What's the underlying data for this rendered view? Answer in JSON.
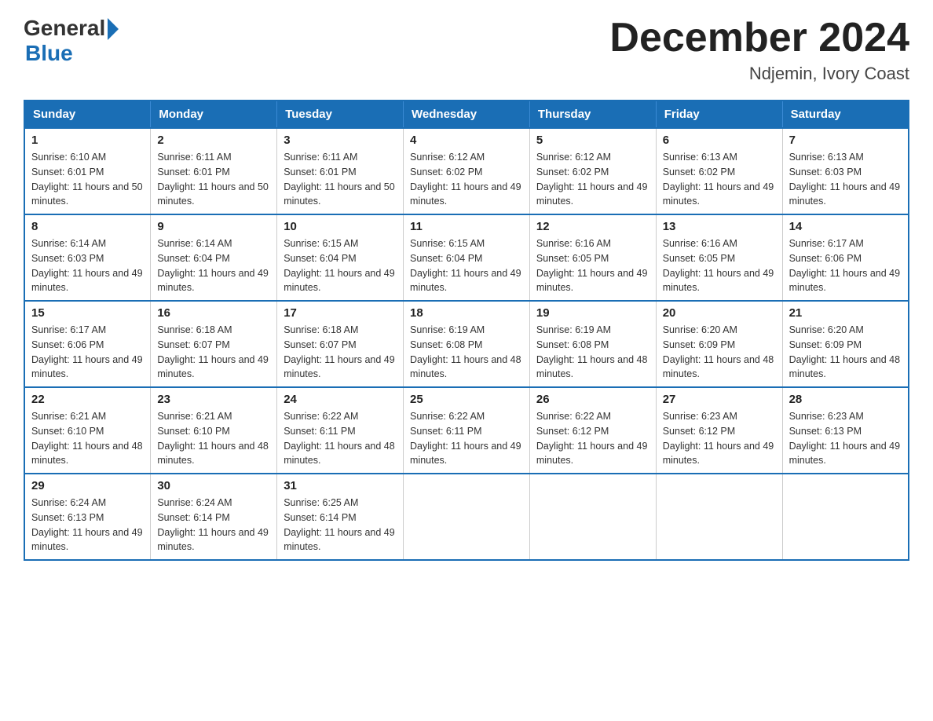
{
  "logo": {
    "general": "General",
    "blue": "Blue"
  },
  "title": {
    "month": "December 2024",
    "location": "Ndjemin, Ivory Coast"
  },
  "weekdays": [
    "Sunday",
    "Monday",
    "Tuesday",
    "Wednesday",
    "Thursday",
    "Friday",
    "Saturday"
  ],
  "weeks": [
    [
      {
        "day": "1",
        "sunrise": "6:10 AM",
        "sunset": "6:01 PM",
        "daylight": "11 hours and 50 minutes."
      },
      {
        "day": "2",
        "sunrise": "6:11 AM",
        "sunset": "6:01 PM",
        "daylight": "11 hours and 50 minutes."
      },
      {
        "day": "3",
        "sunrise": "6:11 AM",
        "sunset": "6:01 PM",
        "daylight": "11 hours and 50 minutes."
      },
      {
        "day": "4",
        "sunrise": "6:12 AM",
        "sunset": "6:02 PM",
        "daylight": "11 hours and 49 minutes."
      },
      {
        "day": "5",
        "sunrise": "6:12 AM",
        "sunset": "6:02 PM",
        "daylight": "11 hours and 49 minutes."
      },
      {
        "day": "6",
        "sunrise": "6:13 AM",
        "sunset": "6:02 PM",
        "daylight": "11 hours and 49 minutes."
      },
      {
        "day": "7",
        "sunrise": "6:13 AM",
        "sunset": "6:03 PM",
        "daylight": "11 hours and 49 minutes."
      }
    ],
    [
      {
        "day": "8",
        "sunrise": "6:14 AM",
        "sunset": "6:03 PM",
        "daylight": "11 hours and 49 minutes."
      },
      {
        "day": "9",
        "sunrise": "6:14 AM",
        "sunset": "6:04 PM",
        "daylight": "11 hours and 49 minutes."
      },
      {
        "day": "10",
        "sunrise": "6:15 AM",
        "sunset": "6:04 PM",
        "daylight": "11 hours and 49 minutes."
      },
      {
        "day": "11",
        "sunrise": "6:15 AM",
        "sunset": "6:04 PM",
        "daylight": "11 hours and 49 minutes."
      },
      {
        "day": "12",
        "sunrise": "6:16 AM",
        "sunset": "6:05 PM",
        "daylight": "11 hours and 49 minutes."
      },
      {
        "day": "13",
        "sunrise": "6:16 AM",
        "sunset": "6:05 PM",
        "daylight": "11 hours and 49 minutes."
      },
      {
        "day": "14",
        "sunrise": "6:17 AM",
        "sunset": "6:06 PM",
        "daylight": "11 hours and 49 minutes."
      }
    ],
    [
      {
        "day": "15",
        "sunrise": "6:17 AM",
        "sunset": "6:06 PM",
        "daylight": "11 hours and 49 minutes."
      },
      {
        "day": "16",
        "sunrise": "6:18 AM",
        "sunset": "6:07 PM",
        "daylight": "11 hours and 49 minutes."
      },
      {
        "day": "17",
        "sunrise": "6:18 AM",
        "sunset": "6:07 PM",
        "daylight": "11 hours and 49 minutes."
      },
      {
        "day": "18",
        "sunrise": "6:19 AM",
        "sunset": "6:08 PM",
        "daylight": "11 hours and 48 minutes."
      },
      {
        "day": "19",
        "sunrise": "6:19 AM",
        "sunset": "6:08 PM",
        "daylight": "11 hours and 48 minutes."
      },
      {
        "day": "20",
        "sunrise": "6:20 AM",
        "sunset": "6:09 PM",
        "daylight": "11 hours and 48 minutes."
      },
      {
        "day": "21",
        "sunrise": "6:20 AM",
        "sunset": "6:09 PM",
        "daylight": "11 hours and 48 minutes."
      }
    ],
    [
      {
        "day": "22",
        "sunrise": "6:21 AM",
        "sunset": "6:10 PM",
        "daylight": "11 hours and 48 minutes."
      },
      {
        "day": "23",
        "sunrise": "6:21 AM",
        "sunset": "6:10 PM",
        "daylight": "11 hours and 48 minutes."
      },
      {
        "day": "24",
        "sunrise": "6:22 AM",
        "sunset": "6:11 PM",
        "daylight": "11 hours and 48 minutes."
      },
      {
        "day": "25",
        "sunrise": "6:22 AM",
        "sunset": "6:11 PM",
        "daylight": "11 hours and 49 minutes."
      },
      {
        "day": "26",
        "sunrise": "6:22 AM",
        "sunset": "6:12 PM",
        "daylight": "11 hours and 49 minutes."
      },
      {
        "day": "27",
        "sunrise": "6:23 AM",
        "sunset": "6:12 PM",
        "daylight": "11 hours and 49 minutes."
      },
      {
        "day": "28",
        "sunrise": "6:23 AM",
        "sunset": "6:13 PM",
        "daylight": "11 hours and 49 minutes."
      }
    ],
    [
      {
        "day": "29",
        "sunrise": "6:24 AM",
        "sunset": "6:13 PM",
        "daylight": "11 hours and 49 minutes."
      },
      {
        "day": "30",
        "sunrise": "6:24 AM",
        "sunset": "6:14 PM",
        "daylight": "11 hours and 49 minutes."
      },
      {
        "day": "31",
        "sunrise": "6:25 AM",
        "sunset": "6:14 PM",
        "daylight": "11 hours and 49 minutes."
      },
      null,
      null,
      null,
      null
    ]
  ]
}
